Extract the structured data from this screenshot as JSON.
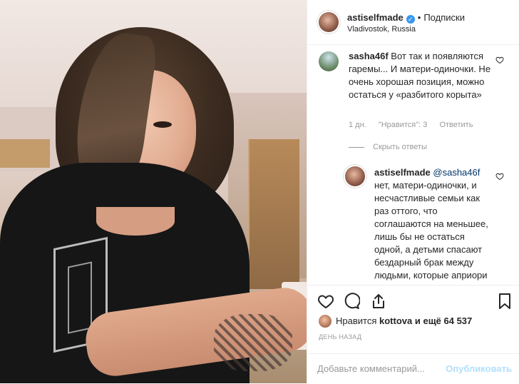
{
  "header": {
    "username": "astiselfmade",
    "verified_mark": "✓",
    "separator": "•",
    "follow_label": "Подписки",
    "location": "Vladivostok, Russia"
  },
  "comments": [
    {
      "username": "sasha46f",
      "text": "Вот так и появляются гаремы... И матери-одиночки. Не очень хорошая позиция, можно остаться у «разбитого корыта»",
      "time": "1 дн.",
      "likes": "\"Нравится\": 3",
      "reply_label": "Ответить",
      "hide_replies": "Скрыть ответы",
      "replies": [
        {
          "username": "astiselfmade",
          "mention": "@sasha46f",
          "text": "нет, матери-одиночки, и несчастливые семьи как раз оттого, что соглашаются на меньшее, лишь бы не остаться одной, а детьми спасают бездарный брак между людьми, которые априори не знают что"
        }
      ]
    }
  ],
  "actions": {
    "like_icon": "heart-icon",
    "comment_icon": "comment-icon",
    "share_icon": "share-icon",
    "save_icon": "bookmark-icon"
  },
  "likes": {
    "prefix": "Нравится",
    "user": "kottova",
    "suffix": "и ещё 64 537"
  },
  "time_ago": "ДЕНЬ НАЗАД",
  "add_comment": {
    "placeholder": "Добавьте комментарий...",
    "post_label": "Опубликовать"
  }
}
